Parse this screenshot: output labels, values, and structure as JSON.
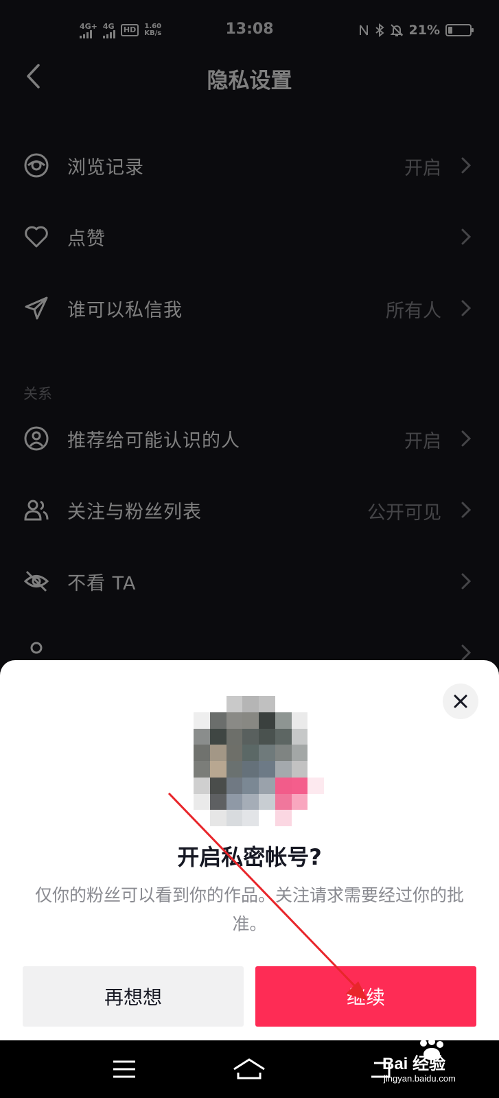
{
  "status_bar": {
    "net1": "4G+",
    "net2": "4G",
    "hd": "HD",
    "speed_value": "1.60",
    "speed_unit": "KB/s",
    "time": "13:08",
    "battery": "21%",
    "battery_level": 0.21
  },
  "header": {
    "title": "隐私设置"
  },
  "rows_top": [
    {
      "label": "浏览记录",
      "value": "开启",
      "icon": "eye-icon"
    },
    {
      "label": "点赞",
      "value": "",
      "icon": "heart-icon"
    },
    {
      "label": "谁可以私信我",
      "value": "所有人",
      "icon": "paper-plane-icon"
    }
  ],
  "section_relation": "关系",
  "rows_relation": [
    {
      "label": "推荐给可能认识的人",
      "value": "开启",
      "icon": "user-circle-icon"
    },
    {
      "label": "关注与粉丝列表",
      "value": "公开可见",
      "icon": "users-icon"
    },
    {
      "label": "不看 TA",
      "value": "",
      "icon": "eye-off-icon"
    }
  ],
  "sheet": {
    "title": "开启私密帐号?",
    "description": "仅你的粉丝可以看到你的作品。关注请求需要经过你的批准。",
    "cancel_label": "再想想",
    "continue_label": "继续"
  },
  "watermark": {
    "line1": "Bai 经验",
    "line2": "jingyan.baidu.com"
  },
  "colors": {
    "accent": "#fe2c55",
    "background": "#16161c",
    "sheet": "#ffffff",
    "annotation": "#e8262b"
  }
}
